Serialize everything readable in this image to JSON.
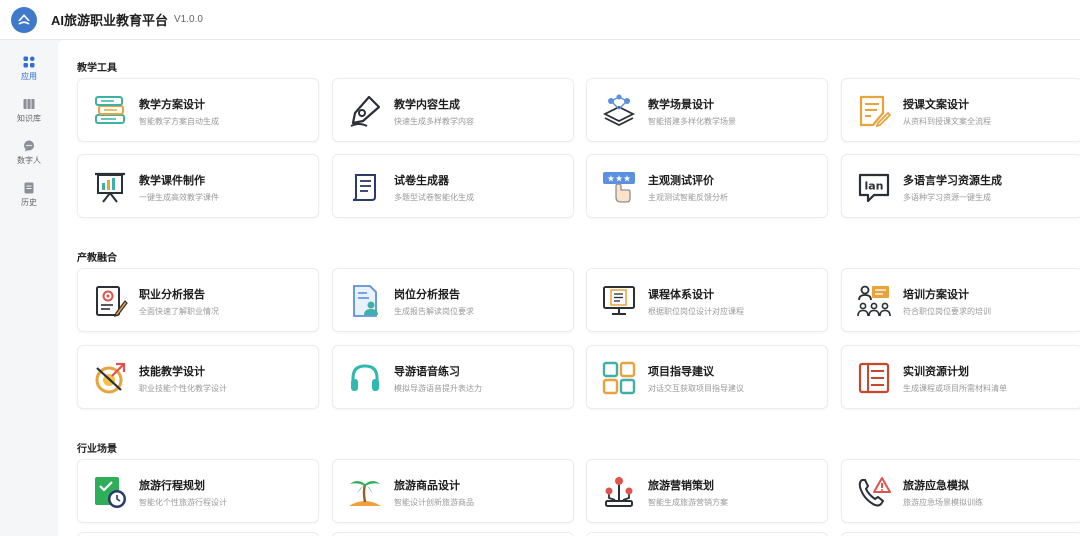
{
  "app": {
    "title": "AI旅游职业教育平台",
    "version": "V1.0.0"
  },
  "sidebar": {
    "items": [
      {
        "label": "应用",
        "icon": "grid-apps-icon"
      },
      {
        "label": "知识库",
        "icon": "library-icon"
      },
      {
        "label": "数字人",
        "icon": "chat-bubble-icon"
      },
      {
        "label": "历史",
        "icon": "history-doc-icon"
      }
    ]
  },
  "sections": [
    {
      "title": "教学工具",
      "cards": [
        {
          "title": "教学方案设计",
          "subtitle": "智能教学方案自动生成",
          "icon": "stacked-books-icon"
        },
        {
          "title": "教学内容生成",
          "subtitle": "快速生成多样教学内容",
          "icon": "pen-nib-icon"
        },
        {
          "title": "教学场景设计",
          "subtitle": "智能搭建多样化教学场景",
          "icon": "layers-network-icon"
        },
        {
          "title": "授课文案设计",
          "subtitle": "从资料到授课文案全流程",
          "icon": "document-pencil-icon"
        },
        {
          "title": "教学课件制作",
          "subtitle": "一键生成高效教学课件",
          "icon": "presentation-board-icon"
        },
        {
          "title": "试卷生成器",
          "subtitle": "多题型试卷智能化生成",
          "icon": "exam-scroll-icon"
        },
        {
          "title": "主观测试评价",
          "subtitle": "主观测试智能反馈分析",
          "icon": "rating-stars-icon"
        },
        {
          "title": "多语言学习资源生成",
          "subtitle": "多语种学习资源一键生成",
          "icon": "language-bubble-icon",
          "icon_text": "lan"
        }
      ]
    },
    {
      "title": "产教融合",
      "cards": [
        {
          "title": "职业分析报告",
          "subtitle": "全面快速了解职业情况",
          "icon": "career-report-icon"
        },
        {
          "title": "岗位分析报告",
          "subtitle": "生成报告解读岗位要求",
          "icon": "position-report-icon"
        },
        {
          "title": "课程体系设计",
          "subtitle": "根据职位岗位设计对应课程",
          "icon": "course-monitor-icon"
        },
        {
          "title": "培训方案设计",
          "subtitle": "符合职位岗位要求的培训",
          "icon": "training-group-icon"
        },
        {
          "title": "技能教学设计",
          "subtitle": "职业技能个性化教学设计",
          "icon": "skill-compass-icon"
        },
        {
          "title": "导游语音练习",
          "subtitle": "模拟导游语音提升表达力",
          "icon": "headphones-icon"
        },
        {
          "title": "项目指导建议",
          "subtitle": "对话交互获取项目指导建议",
          "icon": "tiles-grid-icon"
        },
        {
          "title": "实训资源计划",
          "subtitle": "生成课程或项目所需材料清单",
          "icon": "resource-list-icon"
        }
      ]
    },
    {
      "title": "行业场景",
      "cards": [
        {
          "title": "旅游行程规划",
          "subtitle": "智能化个性旅游行程设计",
          "icon": "itinerary-clock-icon"
        },
        {
          "title": "旅游商品设计",
          "subtitle": "智能设计创新旅游商品",
          "icon": "palm-island-icon"
        },
        {
          "title": "旅游营销策划",
          "subtitle": "智能生成旅游营销方案",
          "icon": "marketing-pins-icon"
        },
        {
          "title": "旅游应急模拟",
          "subtitle": "旅游应急场景模拟训练",
          "icon": "emergency-call-icon"
        }
      ]
    }
  ],
  "colors": {
    "accent": "#2d6fd6",
    "logo": "#3f79c9",
    "page_bg": "#f3f4f6"
  }
}
